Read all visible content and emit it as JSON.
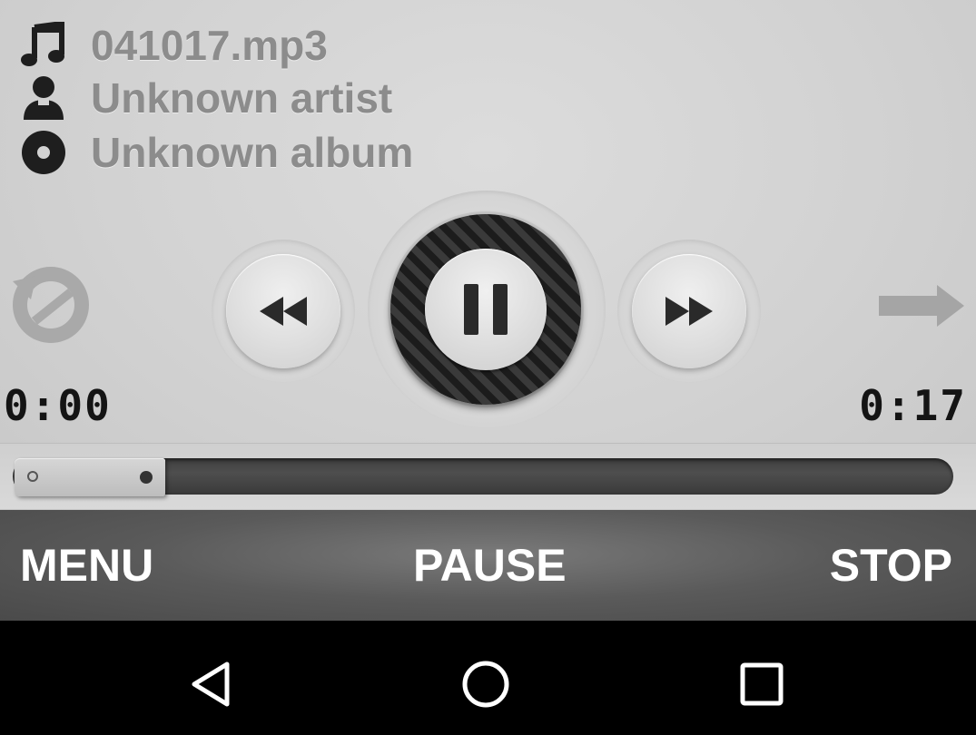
{
  "track": {
    "title": "041017.mp3",
    "artist": "Unknown artist",
    "album": "Unknown album"
  },
  "icons": {
    "title": "music-note-icon",
    "artist": "person-icon",
    "album": "disc-icon"
  },
  "controls": {
    "repeat": "repeat-icon",
    "rewind": "rewind-icon",
    "play_pause": "pause-icon",
    "forward": "fast-forward-icon",
    "next": "arrow-right-icon"
  },
  "time": {
    "elapsed": "0:00",
    "total": "0:17"
  },
  "progress": {
    "fraction": 0.0
  },
  "bottom_bar": {
    "menu_label": "MENU",
    "pause_label": "PAUSE",
    "stop_label": "STOP"
  },
  "nav": {
    "back": "back-triangle-icon",
    "home": "home-circle-icon",
    "recents": "recents-square-icon"
  },
  "colors": {
    "player_bg": "#d2d2d2",
    "info_text": "#8c8c8c",
    "bottom_bar": "#5a5a5a",
    "nav_bg": "#000000"
  }
}
